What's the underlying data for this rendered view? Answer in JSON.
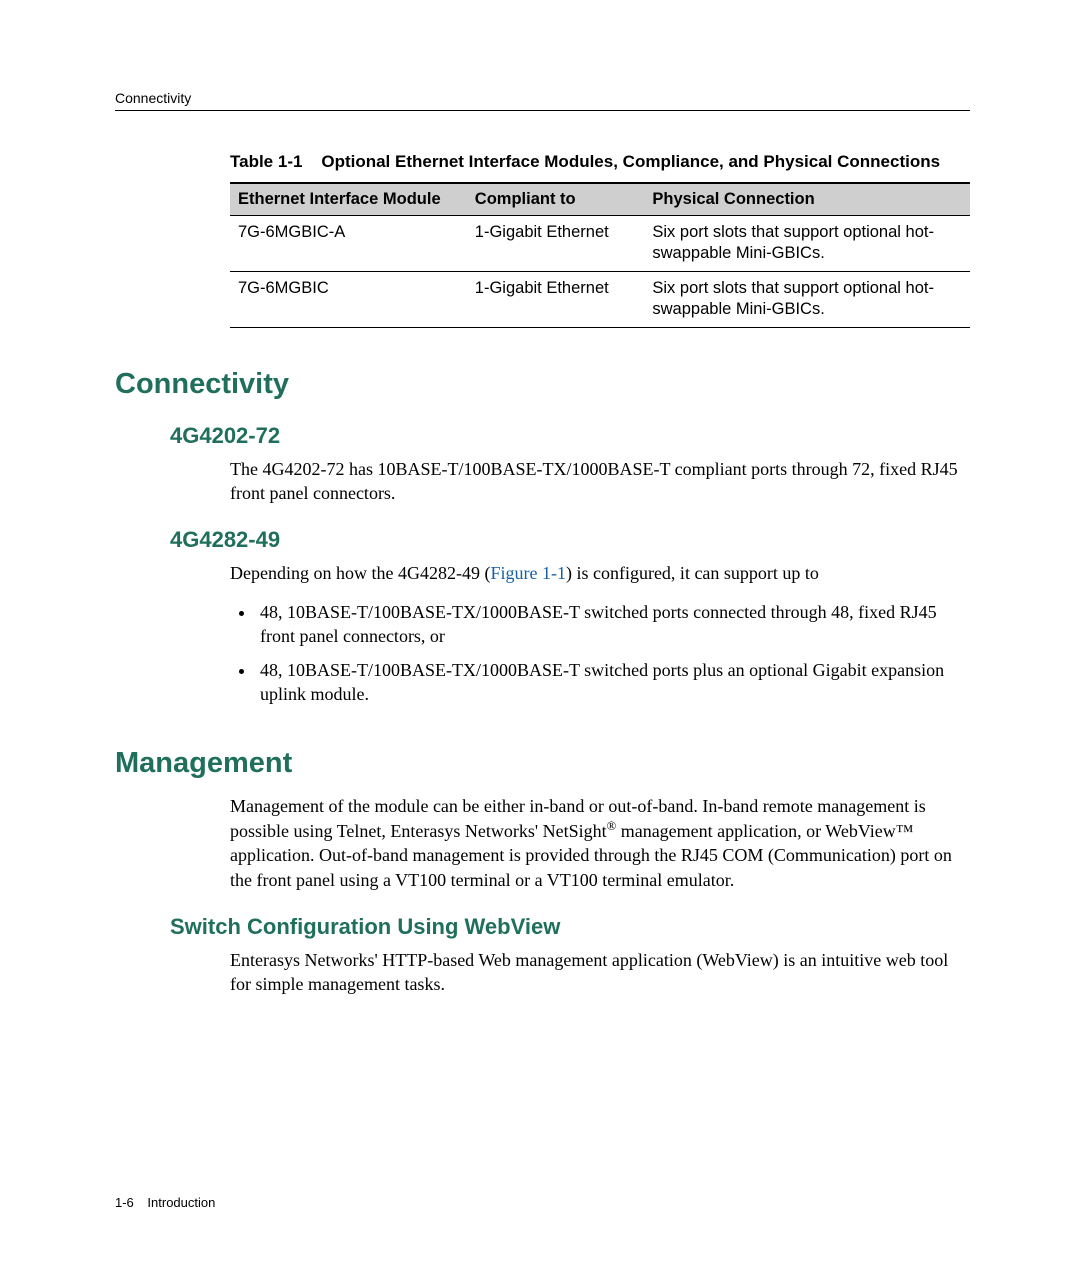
{
  "header": {
    "running": "Connectivity"
  },
  "table": {
    "caption_label": "Table 1-1",
    "caption_text": "Optional Ethernet Interface Modules, Compliance, and Physical Connections",
    "headers": [
      "Ethernet Interface Module",
      "Compliant to",
      "Physical Connection"
    ],
    "rows": [
      {
        "module": "7G-6MGBIC-A",
        "compliant": "1-Gigabit Ethernet",
        "conn": "Six port slots that support optional hot-swappable Mini-GBICs."
      },
      {
        "module": "7G-6MGBIC",
        "compliant": "1-Gigabit Ethernet",
        "conn": "Six port slots that support optional hot-swappable Mini-GBICs."
      }
    ]
  },
  "sections": {
    "connectivity": {
      "title": "Connectivity",
      "s1": {
        "title": "4G4202-72",
        "p1": "The 4G4202-72 has 10BASE-T/100BASE-TX/1000BASE-T compliant ports through 72, fixed RJ45 front panel connectors."
      },
      "s2": {
        "title": "4G4282-49",
        "p1a": "Depending on how the 4G4282-49 (",
        "p1link": "Figure 1-1",
        "p1b": ") is configured, it can support up to",
        "bullets": [
          "48, 10BASE-T/100BASE-TX/1000BASE-T switched ports connected through 48, fixed RJ45 front panel connectors, or",
          "48, 10BASE-T/100BASE-TX/1000BASE-T switched ports plus an optional Gigabit expansion uplink module."
        ]
      }
    },
    "management": {
      "title": "Management",
      "p1a": "Management of the module can be either in-band or out-of-band. In-band remote management is possible using Telnet, Enterasys Networks' NetSight",
      "reg": "®",
      "p1b": " management application, or WebView™ application. Out-of-band management is provided through the RJ45 COM (Communication) port on the front panel using a VT100 terminal or a VT100 terminal emulator.",
      "s1": {
        "title": "Switch Configuration Using WebView",
        "p1": "Enterasys Networks' HTTP-based Web management application (WebView) is an intuitive web tool for simple management tasks."
      }
    }
  },
  "footer": {
    "pageno": "1-6",
    "chapter": "Introduction"
  }
}
